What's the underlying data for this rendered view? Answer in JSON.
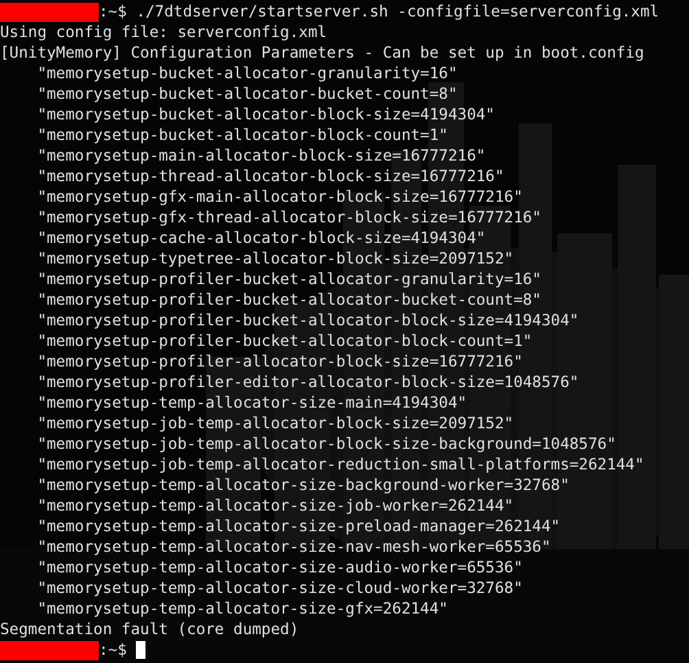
{
  "lines": [
    {
      "kind": "prompt",
      "prompt": ":~$",
      "command": "./7dtdserver/startserver.sh -configfile=serverconfig.xml"
    },
    {
      "kind": "output",
      "text": "Using config file: serverconfig.xml"
    },
    {
      "kind": "output",
      "text": "[UnityMemory] Configuration Parameters - Can be set up in boot.config"
    },
    {
      "kind": "param",
      "text": "\"memorysetup-bucket-allocator-granularity=16\""
    },
    {
      "kind": "param",
      "text": "\"memorysetup-bucket-allocator-bucket-count=8\""
    },
    {
      "kind": "param",
      "text": "\"memorysetup-bucket-allocator-block-size=4194304\""
    },
    {
      "kind": "param",
      "text": "\"memorysetup-bucket-allocator-block-count=1\""
    },
    {
      "kind": "param",
      "text": "\"memorysetup-main-allocator-block-size=16777216\""
    },
    {
      "kind": "param",
      "text": "\"memorysetup-thread-allocator-block-size=16777216\""
    },
    {
      "kind": "param",
      "text": "\"memorysetup-gfx-main-allocator-block-size=16777216\""
    },
    {
      "kind": "param",
      "text": "\"memorysetup-gfx-thread-allocator-block-size=16777216\""
    },
    {
      "kind": "param",
      "text": "\"memorysetup-cache-allocator-block-size=4194304\""
    },
    {
      "kind": "param",
      "text": "\"memorysetup-typetree-allocator-block-size=2097152\""
    },
    {
      "kind": "param",
      "text": "\"memorysetup-profiler-bucket-allocator-granularity=16\""
    },
    {
      "kind": "param",
      "text": "\"memorysetup-profiler-bucket-allocator-bucket-count=8\""
    },
    {
      "kind": "param",
      "text": "\"memorysetup-profiler-bucket-allocator-block-size=4194304\""
    },
    {
      "kind": "param",
      "text": "\"memorysetup-profiler-bucket-allocator-block-count=1\""
    },
    {
      "kind": "param",
      "text": "\"memorysetup-profiler-allocator-block-size=16777216\""
    },
    {
      "kind": "param",
      "text": "\"memorysetup-profiler-editor-allocator-block-size=1048576\""
    },
    {
      "kind": "param",
      "text": "\"memorysetup-temp-allocator-size-main=4194304\""
    },
    {
      "kind": "param",
      "text": "\"memorysetup-job-temp-allocator-block-size=2097152\""
    },
    {
      "kind": "param",
      "text": "\"memorysetup-job-temp-allocator-block-size-background=1048576\""
    },
    {
      "kind": "param",
      "text": "\"memorysetup-job-temp-allocator-reduction-small-platforms=262144\""
    },
    {
      "kind": "param",
      "text": "\"memorysetup-temp-allocator-size-background-worker=32768\""
    },
    {
      "kind": "param",
      "text": "\"memorysetup-temp-allocator-size-job-worker=262144\""
    },
    {
      "kind": "param",
      "text": "\"memorysetup-temp-allocator-size-preload-manager=262144\""
    },
    {
      "kind": "param",
      "text": "\"memorysetup-temp-allocator-size-nav-mesh-worker=65536\""
    },
    {
      "kind": "param",
      "text": "\"memorysetup-temp-allocator-size-audio-worker=65536\""
    },
    {
      "kind": "param",
      "text": "\"memorysetup-temp-allocator-size-cloud-worker=32768\""
    },
    {
      "kind": "param",
      "text": "\"memorysetup-temp-allocator-size-gfx=262144\""
    },
    {
      "kind": "output",
      "text": "Segmentation fault (core dumped)"
    },
    {
      "kind": "prompt",
      "prompt": ":~$",
      "cursor": true
    }
  ]
}
